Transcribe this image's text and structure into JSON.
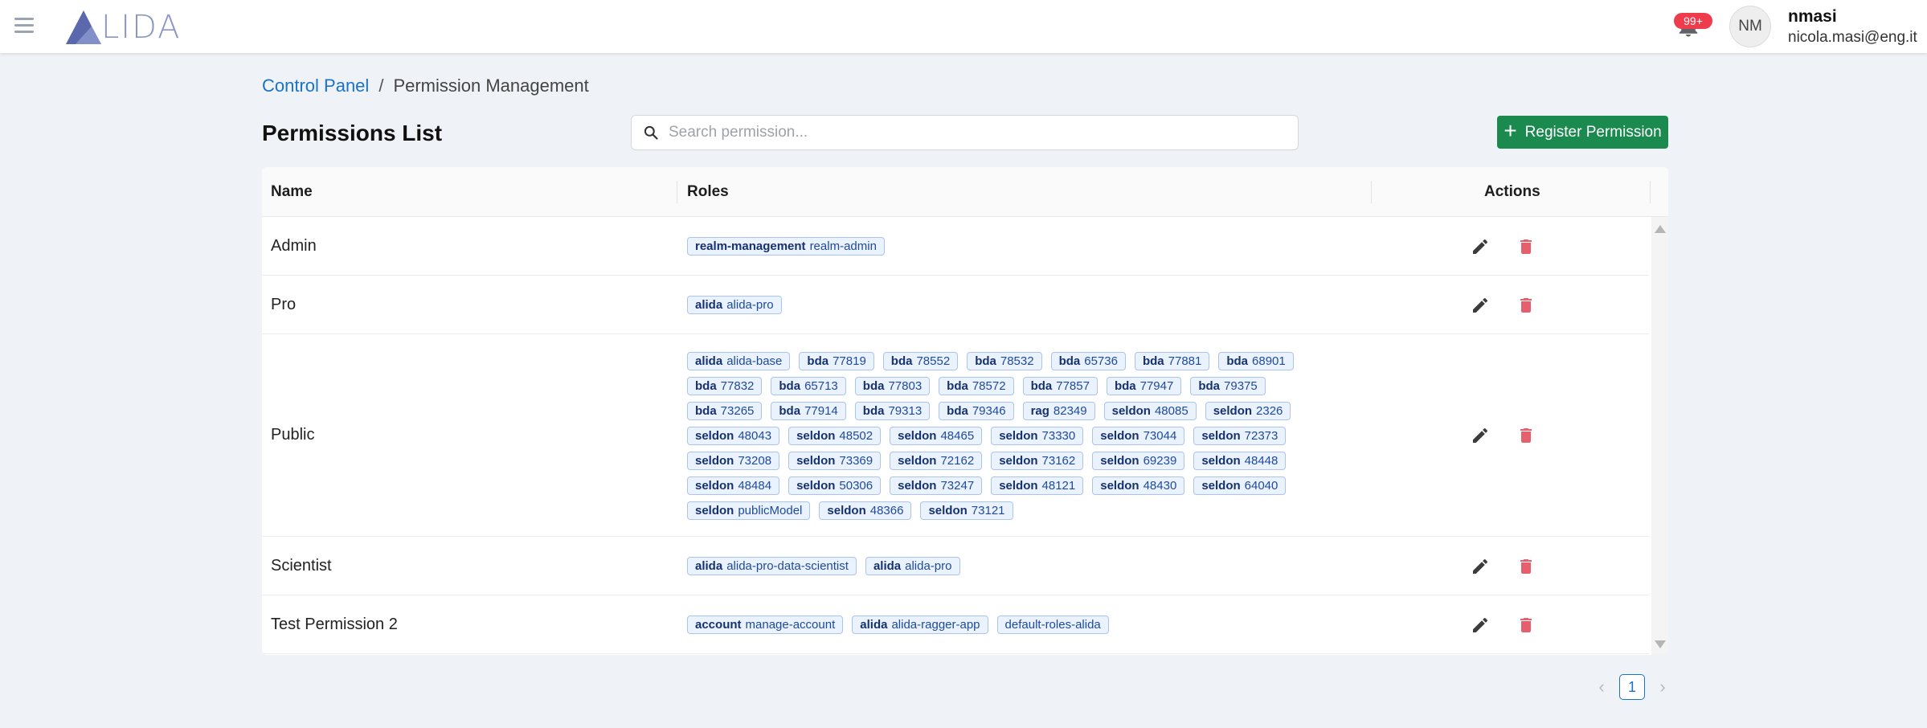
{
  "header": {
    "logo_text": "LIDA",
    "notifications_badge": "99+",
    "avatar_initials": "NM",
    "user_name": "nmasi",
    "user_email": "nicola.masi@eng.it"
  },
  "breadcrumb": {
    "root": "Control Panel",
    "separator": "/",
    "current": "Permission Management"
  },
  "page": {
    "title": "Permissions List",
    "search_placeholder": "Search permission...",
    "register_label": "Register Permission"
  },
  "table": {
    "columns": {
      "name": "Name",
      "roles": "Roles",
      "actions": "Actions"
    },
    "rows": [
      {
        "name": "Admin",
        "roles": [
          {
            "client": "realm-management",
            "role": "realm-admin"
          }
        ]
      },
      {
        "name": "Pro",
        "roles": [
          {
            "client": "alida",
            "role": "alida-pro"
          }
        ]
      },
      {
        "name": "Public",
        "roles": [
          {
            "client": "alida",
            "role": "alida-base"
          },
          {
            "client": "bda",
            "role": "77819"
          },
          {
            "client": "bda",
            "role": "78552"
          },
          {
            "client": "bda",
            "role": "78532"
          },
          {
            "client": "bda",
            "role": "65736"
          },
          {
            "client": "bda",
            "role": "77881"
          },
          {
            "client": "bda",
            "role": "68901"
          },
          {
            "client": "bda",
            "role": "77832"
          },
          {
            "client": "bda",
            "role": "65713"
          },
          {
            "client": "bda",
            "role": "77803"
          },
          {
            "client": "bda",
            "role": "78572"
          },
          {
            "client": "bda",
            "role": "77857"
          },
          {
            "client": "bda",
            "role": "77947"
          },
          {
            "client": "bda",
            "role": "79375"
          },
          {
            "client": "bda",
            "role": "73265"
          },
          {
            "client": "bda",
            "role": "77914"
          },
          {
            "client": "bda",
            "role": "79313"
          },
          {
            "client": "bda",
            "role": "79346"
          },
          {
            "client": "rag",
            "role": "82349"
          },
          {
            "client": "seldon",
            "role": "48085"
          },
          {
            "client": "seldon",
            "role": "2326"
          },
          {
            "client": "seldon",
            "role": "48043"
          },
          {
            "client": "seldon",
            "role": "48502"
          },
          {
            "client": "seldon",
            "role": "48465"
          },
          {
            "client": "seldon",
            "role": "73330"
          },
          {
            "client": "seldon",
            "role": "73044"
          },
          {
            "client": "seldon",
            "role": "72373"
          },
          {
            "client": "seldon",
            "role": "73208"
          },
          {
            "client": "seldon",
            "role": "73369"
          },
          {
            "client": "seldon",
            "role": "72162"
          },
          {
            "client": "seldon",
            "role": "73162"
          },
          {
            "client": "seldon",
            "role": "69239"
          },
          {
            "client": "seldon",
            "role": "48448"
          },
          {
            "client": "seldon",
            "role": "48484"
          },
          {
            "client": "seldon",
            "role": "50306"
          },
          {
            "client": "seldon",
            "role": "73247"
          },
          {
            "client": "seldon",
            "role": "48121"
          },
          {
            "client": "seldon",
            "role": "48430"
          },
          {
            "client": "seldon",
            "role": "64040"
          },
          {
            "client": "seldon",
            "role": "publicModel"
          },
          {
            "client": "seldon",
            "role": "48366"
          },
          {
            "client": "seldon",
            "role": "73121"
          }
        ]
      },
      {
        "name": "Scientist",
        "roles": [
          {
            "client": "alida",
            "role": "alida-pro-data-scientist"
          },
          {
            "client": "alida",
            "role": "alida-pro"
          }
        ]
      },
      {
        "name": "Test Permission 2",
        "roles": [
          {
            "client": "account",
            "role": "manage-account"
          },
          {
            "client": "alida",
            "role": "alida-ragger-app"
          },
          {
            "client": "",
            "role": "default-roles-alida"
          }
        ]
      }
    ]
  },
  "pagination": {
    "current_page": "1",
    "prev": "‹",
    "next": "›"
  },
  "colors": {
    "primary": "#1a73c8",
    "success": "#1a8a4f",
    "danger": "#ee3c4d",
    "tag_bg": "#eaf2fe",
    "tag_border": "#a9c5ef"
  }
}
